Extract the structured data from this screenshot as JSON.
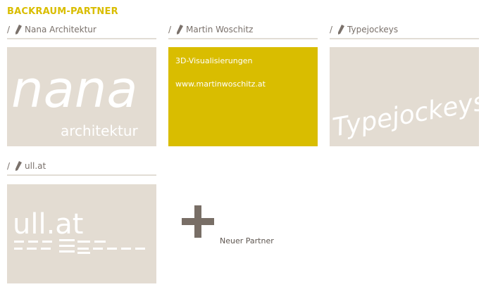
{
  "section": {
    "title": "BACKRAUM-PARTNER"
  },
  "cards": [
    {
      "slash": "/",
      "name": "Nana Architektur",
      "logo_text_main": "nana",
      "logo_text_sub": "architektur"
    },
    {
      "slash": "/",
      "name": "Martin Woschitz",
      "info_line1": "3D-Visualisierungen",
      "info_url": "www.martinwoschitz.at"
    },
    {
      "slash": "/",
      "name": "Typejockeys",
      "logo_text_main": "Typejockeys"
    },
    {
      "slash": "/",
      "name": "ull.at",
      "logo_text_main": "ull.at"
    }
  ],
  "add_partner": {
    "label": "Neuer Partner"
  },
  "colors": {
    "accent": "#d9bd00",
    "tile": "#e3dcd2",
    "text": "#7a716b",
    "plus": "#786e66"
  },
  "icons": {
    "edit": "pencil-icon",
    "add": "plus-icon"
  }
}
